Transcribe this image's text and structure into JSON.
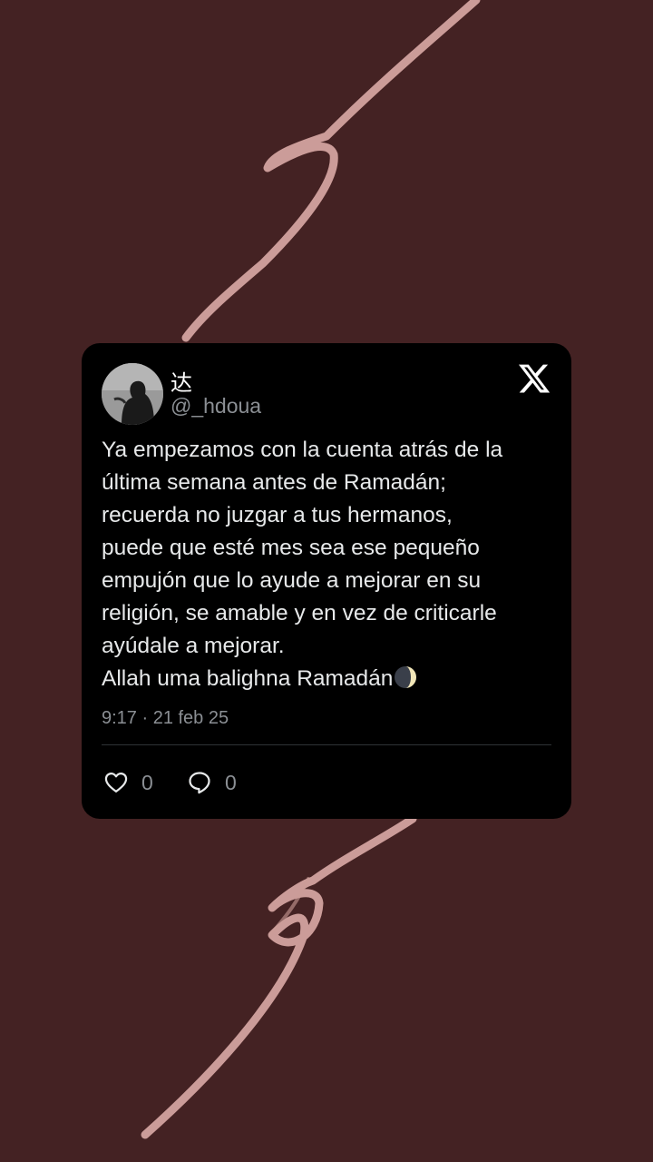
{
  "background_color": "#442223",
  "card_color": "#000000",
  "chalk_color": "#d8a8a4",
  "tweet": {
    "display_name": "达",
    "handle": "@_hdoua",
    "avatar_icon": "profile-photo",
    "platform_icon": "x-logo-icon",
    "lines": [
      "Ya empezamos con la cuenta atrás de la",
      "última semana antes de Ramadán;",
      "recuerda no juzgar a tus hermanos,",
      "puede que esté mes sea ese pequeño",
      "empujón que lo ayude a mejorar en su",
      "religión, se amable y en vez de criticarle",
      "ayúdale a mejorar."
    ],
    "last_line": "Allah uma balighna Ramadán",
    "last_line_icon": "moon-icon",
    "timestamp": "9:17 · 21 feb 25",
    "likes": "0",
    "replies": "0"
  }
}
